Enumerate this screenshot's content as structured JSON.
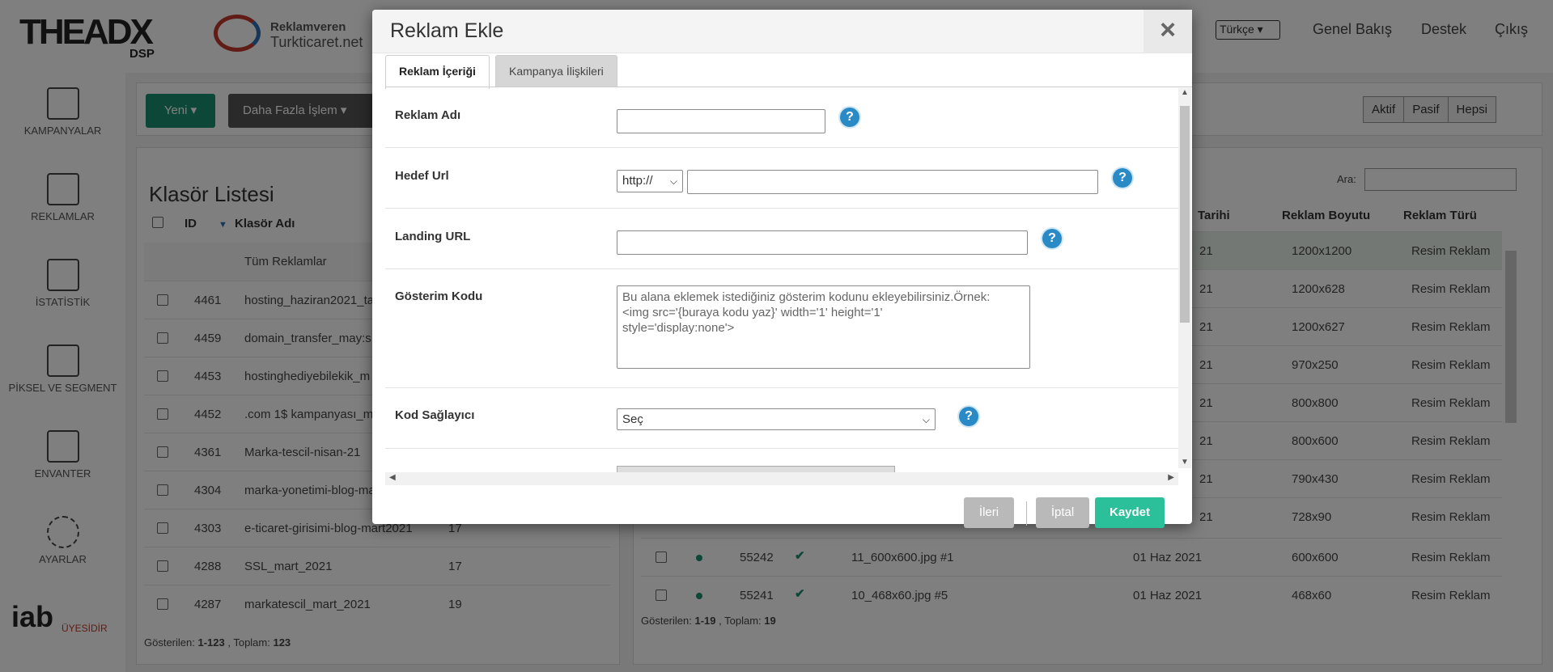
{
  "app": {
    "logo_text": "THEADX",
    "logo_sub": "DSP",
    "advertiser_label": "Reklamveren",
    "advertiser_name": "Turkticaret.net",
    "language": "Türkçe",
    "top_links": [
      "Genel Bakış",
      "Destek",
      "Çıkış"
    ]
  },
  "sidebar": {
    "items": [
      {
        "label": "KAMPANYALAR",
        "icon": "list-icon"
      },
      {
        "label": "REKLAMLAR",
        "icon": "ads-icon"
      },
      {
        "label": "İSTATİSTİK",
        "icon": "chart-icon"
      },
      {
        "label": "PİKSEL VE SEGMENT",
        "icon": "pixel-icon"
      },
      {
        "label": "ENVANTER",
        "icon": "box-icon"
      },
      {
        "label": "AYARLAR",
        "icon": "gear-icon"
      }
    ],
    "iab_text": "iab",
    "iab_sub": "ÜYESİDİR"
  },
  "toolbar": {
    "new_label": "Yeni ▾",
    "more_label": "Daha Fazla İşlem ▾",
    "filters": [
      "Aktif",
      "Pasif",
      "Hepsi"
    ]
  },
  "folders": {
    "title": "Klasör Listesi",
    "columns": [
      "ID",
      "Klasör Adı"
    ],
    "all_label": "Tüm Reklamlar",
    "rows": [
      {
        "id": "4461",
        "name": "hosting_haziran2021_ta",
        "count": ""
      },
      {
        "id": "4459",
        "name": "domain_transfer_may:s",
        "count": ""
      },
      {
        "id": "4453",
        "name": "hostinghediyebilekik_m",
        "count": ""
      },
      {
        "id": "4452",
        "name": ".com 1$ kampanyası_m",
        "count": ""
      },
      {
        "id": "4361",
        "name": "Marka-tescil-nisan-21",
        "count": ""
      },
      {
        "id": "4304",
        "name": "marka-yonetimi-blog-ma",
        "count": ""
      },
      {
        "id": "4303",
        "name": "e-ticaret-girisimi-blog-mart2021",
        "count": "17"
      },
      {
        "id": "4288",
        "name": "SSL_mart_2021",
        "count": "17"
      },
      {
        "id": "4287",
        "name": "markatescil_mart_2021",
        "count": "19"
      }
    ],
    "footer_prefix": "Gösterilen: ",
    "footer_range": "1-123",
    "footer_mid": " , Toplam: ",
    "footer_total": "123"
  },
  "ads": {
    "search_label": "Ara:",
    "columns": [
      "Tarihi",
      "Reklam Boyutu",
      "Reklam Türü"
    ],
    "rows": [
      {
        "date": "21",
        "size": "1200x1200",
        "type": "Resim Reklam"
      },
      {
        "date": "21",
        "size": "1200x628",
        "type": "Resim Reklam"
      },
      {
        "date": "21",
        "size": "1200x627",
        "type": "Resim Reklam"
      },
      {
        "date": "21",
        "size": "970x250",
        "type": "Resim Reklam"
      },
      {
        "date": "21",
        "size": "800x800",
        "type": "Resim Reklam"
      },
      {
        "date": "21",
        "size": "800x600",
        "type": "Resim Reklam"
      },
      {
        "date": "21",
        "size": "790x430",
        "type": "Resim Reklam"
      },
      {
        "date": "21",
        "size": "728x90",
        "type": "Resim Reklam"
      }
    ],
    "full_rows": [
      {
        "id": "55242",
        "name": "11_600x600.jpg #1",
        "date": "01 Haz 2021",
        "size": "600x600",
        "type": "Resim Reklam"
      },
      {
        "id": "55241",
        "name": "10_468x60.jpg #5",
        "date": "01 Haz 2021",
        "size": "468x60",
        "type": "Resim Reklam"
      }
    ],
    "footer_prefix": "Gösterilen: ",
    "footer_range": "1-19",
    "footer_mid": " , Toplam: ",
    "footer_total": "19"
  },
  "modal": {
    "title": "Reklam Ekle",
    "close_label": "×",
    "tabs": [
      "Reklam İçeriği",
      "Kampanya İlişkileri"
    ],
    "fields": {
      "ad_name_label": "Reklam Adı",
      "ad_name_value": "",
      "target_url_label": "Hedef Url",
      "protocol": "http://",
      "target_url_value": "",
      "landing_label": "Landing URL",
      "landing_value": "",
      "impression_label": "Gösterim Kodu",
      "impression_placeholder": "Bu alana eklemek istediğiniz gösterim kodunu ekleyebilirsiniz.Örnek:\n<img src='{buraya kodu yaz}' width='1' height='1'\nstyle='display:none'>",
      "provider_label": "Kod Sağlayıcı",
      "provider_value": "Seç"
    },
    "help_label": "?",
    "buttons": {
      "next": "İleri",
      "cancel": "İptal",
      "save": "Kaydet"
    }
  },
  "colors": {
    "primary_green": "#1a8f6f",
    "save_button": "#2bbf9a",
    "help_blue": "#2a8ac6"
  }
}
